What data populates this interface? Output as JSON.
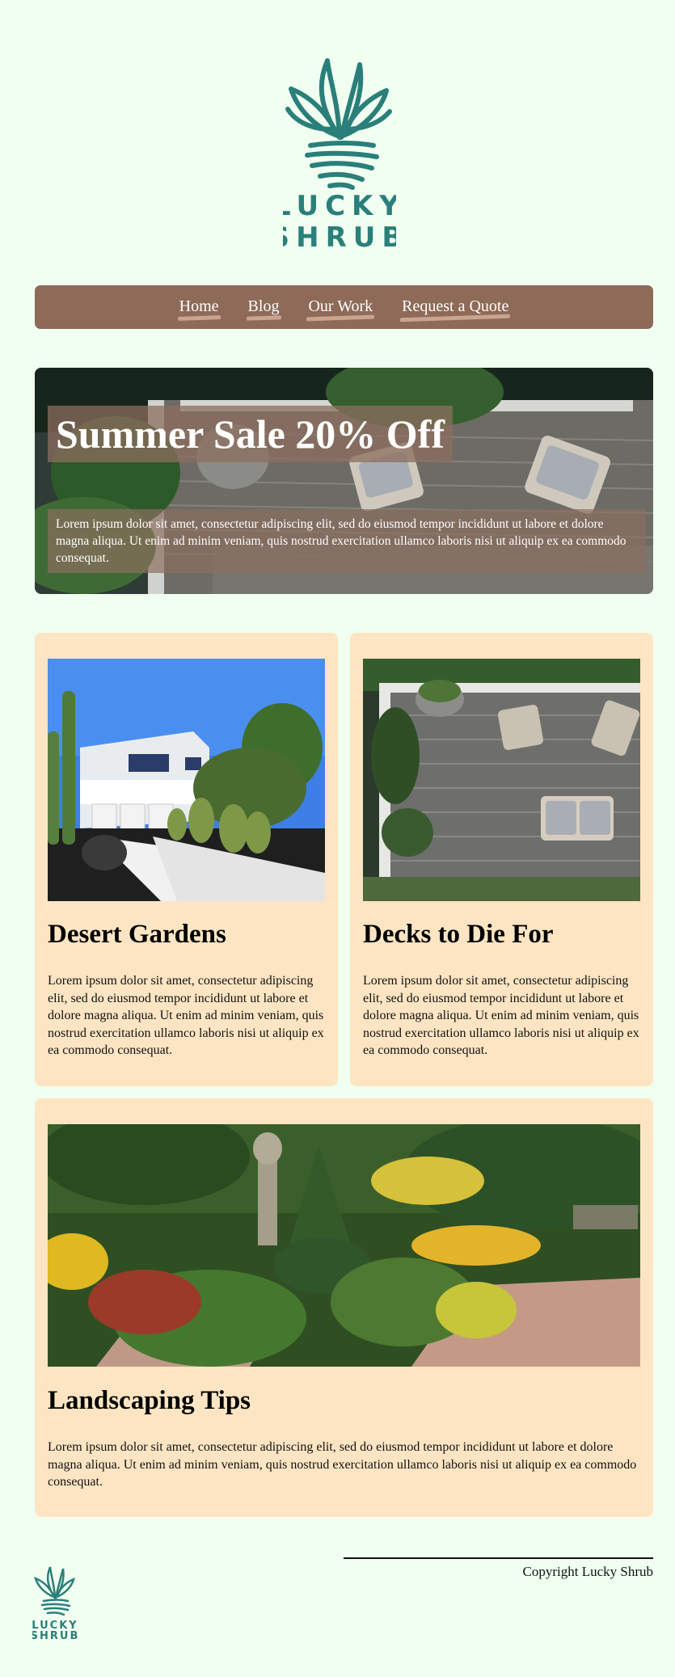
{
  "brand": {
    "name_line1": "LUCKY",
    "name_line2": "SHRUB",
    "logo_color": "#2b7f7a"
  },
  "nav": {
    "items": [
      {
        "label": "Home"
      },
      {
        "label": "Blog"
      },
      {
        "label": "Our Work"
      },
      {
        "label": "Request a Quote"
      }
    ],
    "bg_color": "#8e6a58"
  },
  "hero": {
    "title": "Summer Sale 20% Off",
    "body": "Lorem ipsum dolor sit amet, consectetur adipiscing elit, sed do eiusmod tempor incididunt ut labore et dolore magna aliqua. Ut enim ad minim veniam, quis nostrud exercitation ullamco laboris nisi ut aliquip ex ea commodo consequat."
  },
  "cards": [
    {
      "title": "Desert Gardens",
      "body": "Lorem ipsum dolor sit amet, consectetur adipiscing elit, sed do eiusmod tempor incididunt ut labore et dolore magna aliqua. Ut enim ad minim veniam, quis nostrud exercitation ullamco laboris nisi ut aliquip ex ea commodo consequat.",
      "image": "desert-garden-photo"
    },
    {
      "title": "Decks to Die For",
      "body": "Lorem ipsum dolor sit amet, consectetur adipiscing elit, sed do eiusmod tempor incididunt ut labore et dolore magna aliqua. Ut enim ad minim veniam, quis nostrud exercitation ullamco laboris nisi ut aliquip ex ea commodo consequat.",
      "image": "deck-patio-photo"
    },
    {
      "title": "Landscaping Tips",
      "body": "Lorem ipsum dolor sit amet, consectetur adipiscing elit, sed do eiusmod tempor incididunt ut labore et dolore magna aliqua. Ut enim ad minim veniam, quis nostrud exercitation ullamco laboris nisi ut aliquip ex ea commodo consequat.",
      "image": "flower-garden-photo"
    }
  ],
  "footer": {
    "copyright": "Copyright Lucky Shrub"
  },
  "colors": {
    "page_bg": "#f0fff0",
    "card_bg": "#fde5c3",
    "accent_underline": "#c6a694"
  }
}
